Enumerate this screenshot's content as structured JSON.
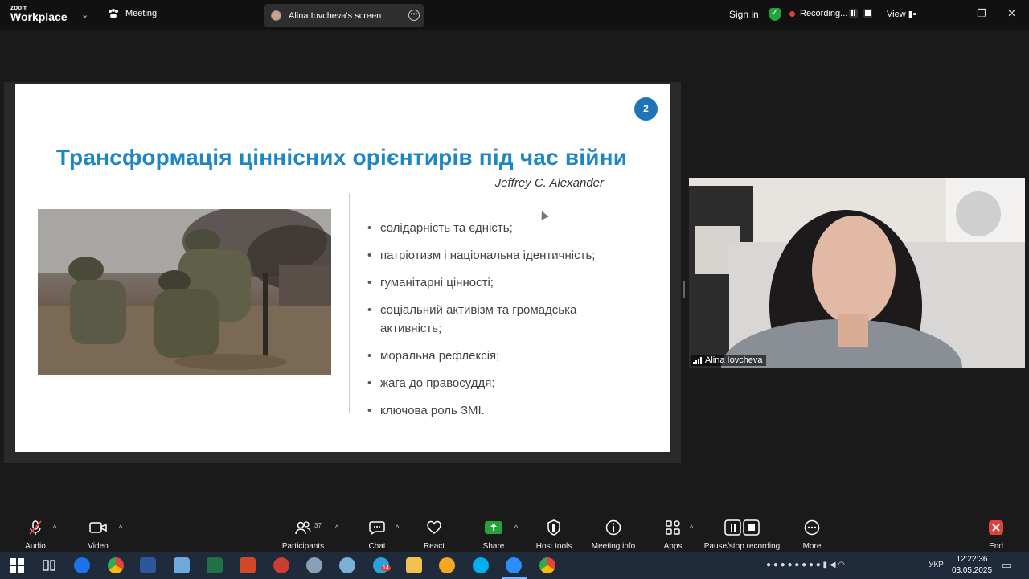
{
  "topbar": {
    "logo_small": "zoom",
    "logo_big": "Workplace",
    "meeting_label": "Meeting",
    "screen_share_label": "Alina Iovcheva's screen",
    "sign_in": "Sign in",
    "recording_label": "Recording...",
    "view_label": "View",
    "icons": [
      "chevron-down-icon",
      "meeting-icon",
      "more-icon",
      "shield-icon",
      "pause-icon",
      "stop-icon",
      "view-icon",
      "minimize-icon",
      "maximize-icon",
      "close-icon"
    ],
    "colors": {
      "shield": "#23a33b",
      "recording_dot": "#e0403a"
    }
  },
  "slide": {
    "number": "2",
    "title": "Трансформація ціннісних орієнтирів під час війни",
    "author": "Jeffrey C. Alexander",
    "bullets": [
      "солідарність та єдність;",
      "патріотизм і національна ідентичність;",
      "гуманітарні цінності;",
      "соціальний активізм та громадська активність;",
      "моральна рефлексія;",
      "жага до правосуддя;",
      "ключова роль ЗМІ."
    ],
    "colors": {
      "title": "#1d86c4",
      "number_badge": "#1f74b8"
    }
  },
  "camera": {
    "participant_name": "Alina Iovcheva"
  },
  "toolbar": {
    "audio": "Audio",
    "video": "Video",
    "participants": "Participants",
    "participants_count": "37",
    "chat": "Chat",
    "react": "React",
    "share": "Share",
    "host_tools": "Host tools",
    "meeting_info": "Meeting info",
    "apps": "Apps",
    "pause_stop": "Pause/stop recording",
    "more": "More",
    "end": "End",
    "colors": {
      "share": "#23a33b",
      "end": "#e0403a"
    }
  },
  "taskbar": {
    "badge_count": "14",
    "lang": "УКР",
    "time": "12:22:36",
    "date": "03.05.2025"
  }
}
